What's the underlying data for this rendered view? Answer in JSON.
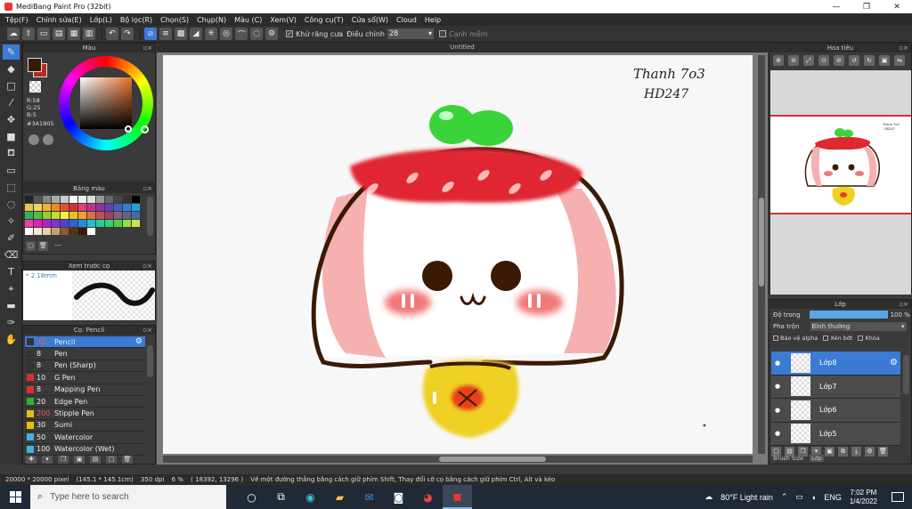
{
  "window": {
    "title": "MediBang Paint Pro (32bit)",
    "controls": [
      "—",
      "❐",
      "✕"
    ]
  },
  "menu": [
    "Tệp(F)",
    "Chỉnh sửa(E)",
    "Lớp(L)",
    "Bộ lọc(R)",
    "Chọn(S)",
    "Chụp(N)",
    "Màu (C)",
    "Xem(V)",
    "Công cụ(T)",
    "Cửa sổ(W)",
    "Cloud",
    "Help"
  ],
  "toolbar": {
    "antialias_label": "Khử răng cưa",
    "adjust_label": "Điều chỉnh",
    "adjust_value": "28",
    "snap_label": "Cạnh mềm",
    "check_mark": "✓"
  },
  "color_panel": {
    "title": "Màu",
    "fg_color": "#3A1905",
    "r": "R:58",
    "g": "G:25",
    "b": "B:5",
    "hex": "#3A1905"
  },
  "palette_panel": {
    "title": "Bảng màu",
    "dashes": "---",
    "swatches": [
      "#222222",
      "#555555",
      "#888888",
      "#aaaaaa",
      "#cccccc",
      "#ffffff",
      "#eeeeee",
      "#dddddd",
      "#999999",
      "#666666",
      "#444444",
      "#333333",
      "#000000",
      "#e8c44a",
      "#f0d060",
      "#f5b030",
      "#f08a20",
      "#e85020",
      "#d83030",
      "#e04070",
      "#c03090",
      "#9030a0",
      "#6040b0",
      "#4060c0",
      "#3080d0",
      "#20a0e0",
      "#30b060",
      "#50c040",
      "#90d030",
      "#c0e020",
      "#f0f040",
      "#f0c020",
      "#f0a030",
      "#e07040",
      "#c05050",
      "#a04060",
      "#806080",
      "#606090",
      "#4070a0",
      "#f040a0",
      "#e020c0",
      "#b020d0",
      "#8030e0",
      "#5040e0",
      "#3060e0",
      "#2090e0",
      "#20c0d0",
      "#20d0a0",
      "#30d070",
      "#50d040",
      "#90e040",
      "#d0e050",
      "#ffffff",
      "#f6e7d0",
      "#e8cfa8",
      "#c8a070",
      "#8a5a30",
      "#5a3010",
      "#3A1905",
      "#ffffff"
    ]
  },
  "preview_panel": {
    "title": "Xem trước cọ",
    "size": "* 2.18mm"
  },
  "brush_panel": {
    "title": "Cọ: Pencil",
    "items": [
      {
        "size": "30",
        "name": "Pencil",
        "color": "#333333",
        "selected": true,
        "size_red": true
      },
      {
        "size": "8",
        "name": "Pen",
        "color": "#333333"
      },
      {
        "size": "8",
        "name": "Pen (Sharp)",
        "color": "#333333"
      },
      {
        "size": "10",
        "name": "G Pen",
        "color": "#d83030"
      },
      {
        "size": "8",
        "name": "Mapping Pen",
        "color": "#d83030"
      },
      {
        "size": "20",
        "name": "Edge Pen",
        "color": "#30b040"
      },
      {
        "size": "200",
        "name": "Stipple Pen",
        "color": "#e8c000",
        "size_red": true
      },
      {
        "size": "30",
        "name": "Sumi",
        "color": "#e8c000"
      },
      {
        "size": "50",
        "name": "Watercolor",
        "color": "#40b0e0"
      },
      {
        "size": "100",
        "name": "Watercolor (Wet)",
        "color": "#40b0e0"
      }
    ]
  },
  "canvas": {
    "tab": "Untitled",
    "signature_line1": "Thanh 7o3",
    "signature_line2": "HD247",
    "colors": {
      "outline": "#3A1905",
      "face": "#ffffff",
      "side": "#f6b0b0",
      "band": "#e02830",
      "leaf": "#3ad43a",
      "bib": "#f0d020",
      "blush": "#f07878"
    }
  },
  "navigator": {
    "title": "Hoa tiêu"
  },
  "layer_panel": {
    "title": "Lớp",
    "opacity_label": "Độ trong",
    "opacity_value": "100 %",
    "blend_label": "Pha trộn",
    "blend_value": "Bình thường",
    "protect_alpha": "Bảo vệ alpha",
    "clipping": "Xén bớt",
    "lock": "Khóa",
    "layers": [
      {
        "name": "Lớp8",
        "selected": true
      },
      {
        "name": "Lớp7"
      },
      {
        "name": "Lớp6"
      },
      {
        "name": "Lớp5"
      }
    ],
    "tabs": [
      "Brush Size",
      "Lớp"
    ]
  },
  "status": {
    "size": "20000 * 20000 pixel",
    "cm": "(145.1 * 145.1cm)",
    "dpi": "350 dpi",
    "zoom": "6 %",
    "coords": "( 18392, 13296 )",
    "hint": "Vẽ một đường thẳng bằng cách giữ phím Shift, Thay đổi cỡ cọ bằng cách giữ phím Ctrl, Alt và kéo"
  },
  "taskbar": {
    "search_placeholder": "Type here to search",
    "weather": "80°F  Light rain",
    "lang": "ENG",
    "time": "7:02 PM",
    "date": "1/4/2022"
  }
}
